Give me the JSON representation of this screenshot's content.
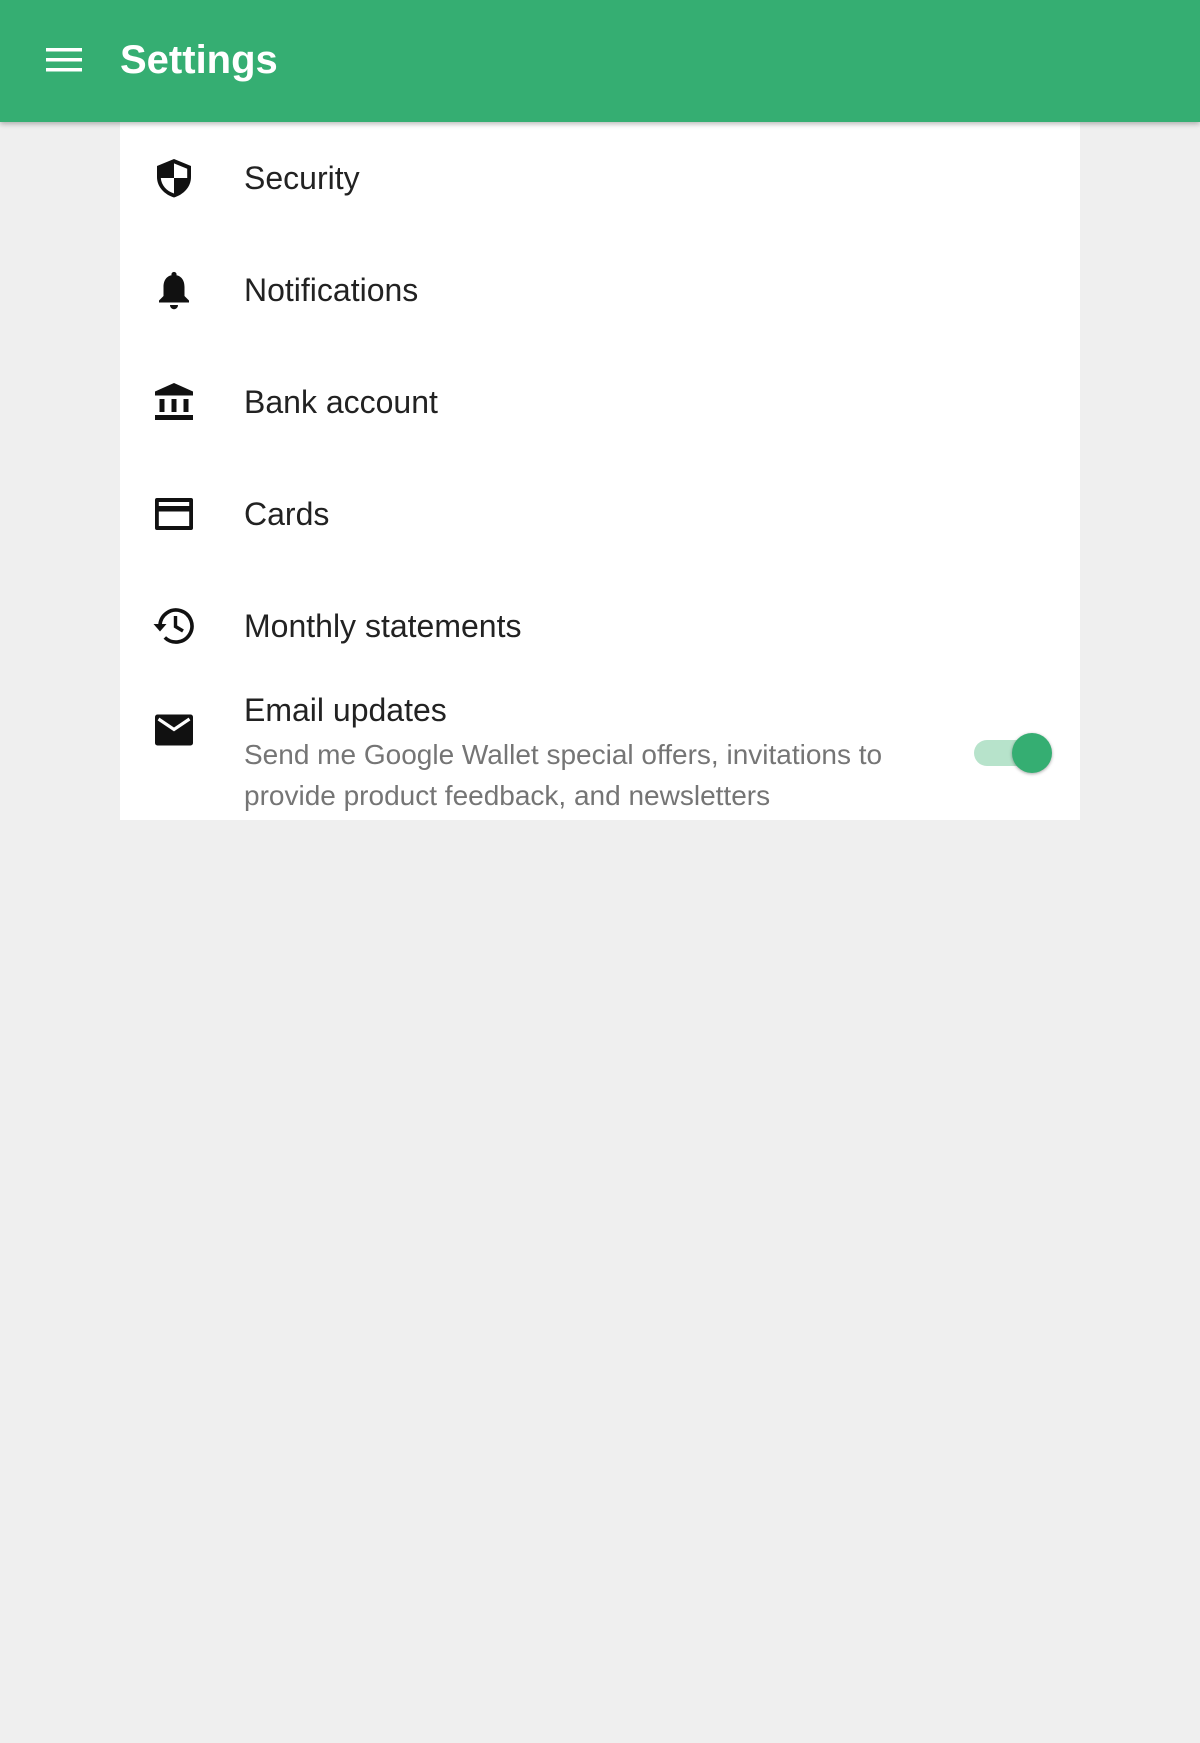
{
  "appbar": {
    "title": "Settings",
    "menu_icon": "menu-icon",
    "color": "#35ae72"
  },
  "settings": {
    "items": [
      {
        "label": "Security",
        "icon": "shield-icon"
      },
      {
        "label": "Notifications",
        "icon": "bell-icon"
      },
      {
        "label": "Bank account",
        "icon": "bank-icon"
      },
      {
        "label": "Cards",
        "icon": "credit-card-icon"
      },
      {
        "label": "Monthly statements",
        "icon": "history-icon"
      }
    ],
    "email": {
      "title": "Email updates",
      "description": "Send me Google Wallet special offers, invitations to provide product feedback, and newsletters",
      "icon": "email-icon",
      "toggle_on": true,
      "toggle_color": "#35ae72"
    }
  }
}
